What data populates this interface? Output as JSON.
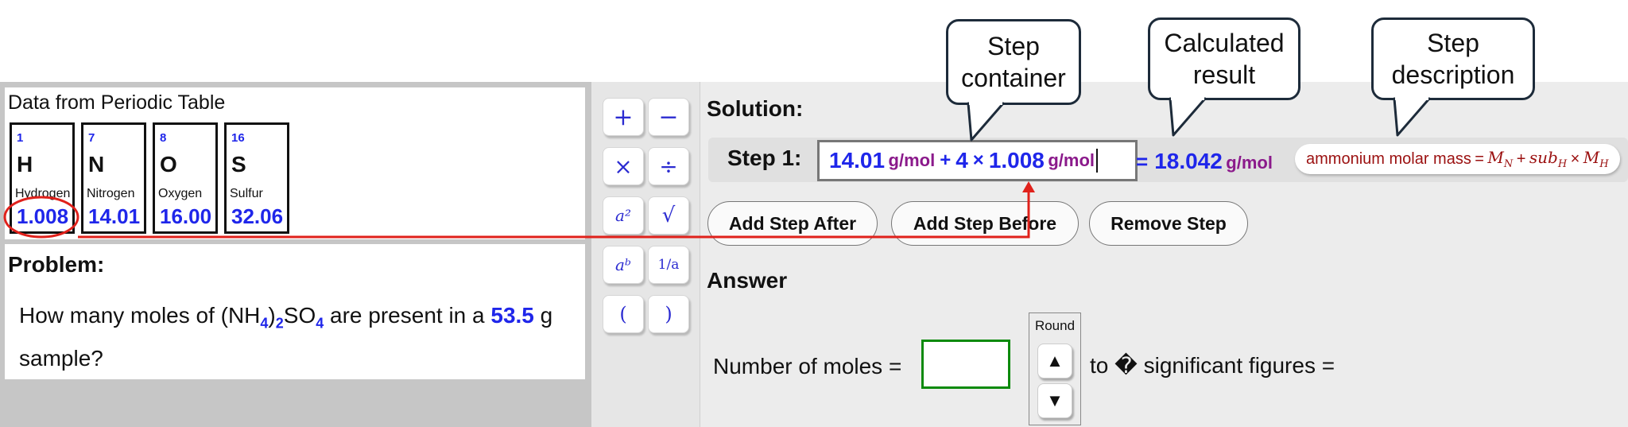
{
  "periodic_table": {
    "title": "Data from Periodic Table",
    "elements": [
      {
        "number": "1",
        "symbol": "H",
        "name": "Hydrogen",
        "mass": "1.008"
      },
      {
        "number": "7",
        "symbol": "N",
        "name": "Nitrogen",
        "mass": "14.01"
      },
      {
        "number": "8",
        "symbol": "O",
        "name": "Oxygen",
        "mass": "16.00"
      },
      {
        "number": "16",
        "symbol": "S",
        "name": "Sulfur",
        "mass": "32.06"
      }
    ]
  },
  "problem": {
    "title": "Problem:",
    "text_part1": "How many moles of (NH",
    "sub1": "4",
    "text_part2": ")",
    "sub2": "2",
    "text_part3": "SO",
    "sub3": "4",
    "text_part4": " are present in a ",
    "amount": "53.5",
    "text_part5": " g sample?"
  },
  "keypad": {
    "plus": "+",
    "minus": "−",
    "times": "×",
    "divide": "÷",
    "square": "a²",
    "sqrt": "√",
    "power": "aᵇ",
    "reciprocal": "1/a",
    "lparen": "(",
    "rparen": ")"
  },
  "solution": {
    "title": "Solution:",
    "step_label": "Step 1:",
    "expr": {
      "v1": "14.01",
      "u1": "g/mol",
      "op1": "+",
      "v2": "4",
      "op2": "×",
      "v3": "1.008",
      "u2": "g/mol"
    },
    "result": {
      "eq": "=",
      "value": "18.042",
      "unit": "g/mol"
    },
    "description": {
      "text": "ammonium molar mass",
      "eq": "=",
      "m1": "M",
      "s1": "N",
      "plus": "+",
      "m2": "sub",
      "s2": "H",
      "times": "×",
      "m3": "M",
      "s3": "H"
    }
  },
  "buttons": {
    "add_after": "Add Step After",
    "add_before": "Add Step Before",
    "remove": "Remove Step"
  },
  "answer": {
    "title": "Answer",
    "label": "Number of moles =",
    "round_label": "Round",
    "up": "▲",
    "down": "▼",
    "suffix": "to � significant figures ="
  },
  "callouts": {
    "step_container": "Step container",
    "calculated_result": "Calculated result",
    "step_description": "Step description"
  },
  "colors": {
    "value_blue": "#1f26ea",
    "unit_purple": "#8b1a8b",
    "desc_red": "#9b1010",
    "annotation_red": "#e0211b",
    "answer_green": "#0c8a0c"
  }
}
